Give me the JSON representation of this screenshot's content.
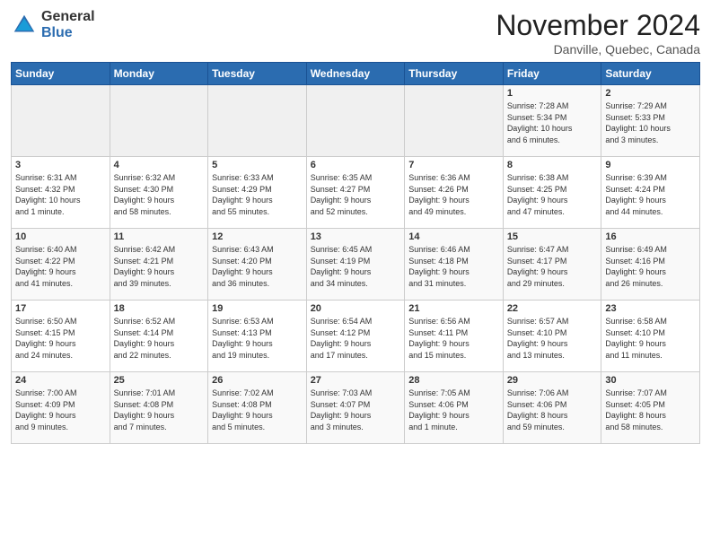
{
  "logo": {
    "line1": "General",
    "line2": "Blue"
  },
  "title": "November 2024",
  "location": "Danville, Quebec, Canada",
  "days_of_week": [
    "Sunday",
    "Monday",
    "Tuesday",
    "Wednesday",
    "Thursday",
    "Friday",
    "Saturday"
  ],
  "weeks": [
    [
      {
        "day": "",
        "info": ""
      },
      {
        "day": "",
        "info": ""
      },
      {
        "day": "",
        "info": ""
      },
      {
        "day": "",
        "info": ""
      },
      {
        "day": "",
        "info": ""
      },
      {
        "day": "1",
        "info": "Sunrise: 7:28 AM\nSunset: 5:34 PM\nDaylight: 10 hours\nand 6 minutes."
      },
      {
        "day": "2",
        "info": "Sunrise: 7:29 AM\nSunset: 5:33 PM\nDaylight: 10 hours\nand 3 minutes."
      }
    ],
    [
      {
        "day": "3",
        "info": "Sunrise: 6:31 AM\nSunset: 4:32 PM\nDaylight: 10 hours\nand 1 minute."
      },
      {
        "day": "4",
        "info": "Sunrise: 6:32 AM\nSunset: 4:30 PM\nDaylight: 9 hours\nand 58 minutes."
      },
      {
        "day": "5",
        "info": "Sunrise: 6:33 AM\nSunset: 4:29 PM\nDaylight: 9 hours\nand 55 minutes."
      },
      {
        "day": "6",
        "info": "Sunrise: 6:35 AM\nSunset: 4:27 PM\nDaylight: 9 hours\nand 52 minutes."
      },
      {
        "day": "7",
        "info": "Sunrise: 6:36 AM\nSunset: 4:26 PM\nDaylight: 9 hours\nand 49 minutes."
      },
      {
        "day": "8",
        "info": "Sunrise: 6:38 AM\nSunset: 4:25 PM\nDaylight: 9 hours\nand 47 minutes."
      },
      {
        "day": "9",
        "info": "Sunrise: 6:39 AM\nSunset: 4:24 PM\nDaylight: 9 hours\nand 44 minutes."
      }
    ],
    [
      {
        "day": "10",
        "info": "Sunrise: 6:40 AM\nSunset: 4:22 PM\nDaylight: 9 hours\nand 41 minutes."
      },
      {
        "day": "11",
        "info": "Sunrise: 6:42 AM\nSunset: 4:21 PM\nDaylight: 9 hours\nand 39 minutes."
      },
      {
        "day": "12",
        "info": "Sunrise: 6:43 AM\nSunset: 4:20 PM\nDaylight: 9 hours\nand 36 minutes."
      },
      {
        "day": "13",
        "info": "Sunrise: 6:45 AM\nSunset: 4:19 PM\nDaylight: 9 hours\nand 34 minutes."
      },
      {
        "day": "14",
        "info": "Sunrise: 6:46 AM\nSunset: 4:18 PM\nDaylight: 9 hours\nand 31 minutes."
      },
      {
        "day": "15",
        "info": "Sunrise: 6:47 AM\nSunset: 4:17 PM\nDaylight: 9 hours\nand 29 minutes."
      },
      {
        "day": "16",
        "info": "Sunrise: 6:49 AM\nSunset: 4:16 PM\nDaylight: 9 hours\nand 26 minutes."
      }
    ],
    [
      {
        "day": "17",
        "info": "Sunrise: 6:50 AM\nSunset: 4:15 PM\nDaylight: 9 hours\nand 24 minutes."
      },
      {
        "day": "18",
        "info": "Sunrise: 6:52 AM\nSunset: 4:14 PM\nDaylight: 9 hours\nand 22 minutes."
      },
      {
        "day": "19",
        "info": "Sunrise: 6:53 AM\nSunset: 4:13 PM\nDaylight: 9 hours\nand 19 minutes."
      },
      {
        "day": "20",
        "info": "Sunrise: 6:54 AM\nSunset: 4:12 PM\nDaylight: 9 hours\nand 17 minutes."
      },
      {
        "day": "21",
        "info": "Sunrise: 6:56 AM\nSunset: 4:11 PM\nDaylight: 9 hours\nand 15 minutes."
      },
      {
        "day": "22",
        "info": "Sunrise: 6:57 AM\nSunset: 4:10 PM\nDaylight: 9 hours\nand 13 minutes."
      },
      {
        "day": "23",
        "info": "Sunrise: 6:58 AM\nSunset: 4:10 PM\nDaylight: 9 hours\nand 11 minutes."
      }
    ],
    [
      {
        "day": "24",
        "info": "Sunrise: 7:00 AM\nSunset: 4:09 PM\nDaylight: 9 hours\nand 9 minutes."
      },
      {
        "day": "25",
        "info": "Sunrise: 7:01 AM\nSunset: 4:08 PM\nDaylight: 9 hours\nand 7 minutes."
      },
      {
        "day": "26",
        "info": "Sunrise: 7:02 AM\nSunset: 4:08 PM\nDaylight: 9 hours\nand 5 minutes."
      },
      {
        "day": "27",
        "info": "Sunrise: 7:03 AM\nSunset: 4:07 PM\nDaylight: 9 hours\nand 3 minutes."
      },
      {
        "day": "28",
        "info": "Sunrise: 7:05 AM\nSunset: 4:06 PM\nDaylight: 9 hours\nand 1 minute."
      },
      {
        "day": "29",
        "info": "Sunrise: 7:06 AM\nSunset: 4:06 PM\nDaylight: 8 hours\nand 59 minutes."
      },
      {
        "day": "30",
        "info": "Sunrise: 7:07 AM\nSunset: 4:05 PM\nDaylight: 8 hours\nand 58 minutes."
      }
    ]
  ]
}
